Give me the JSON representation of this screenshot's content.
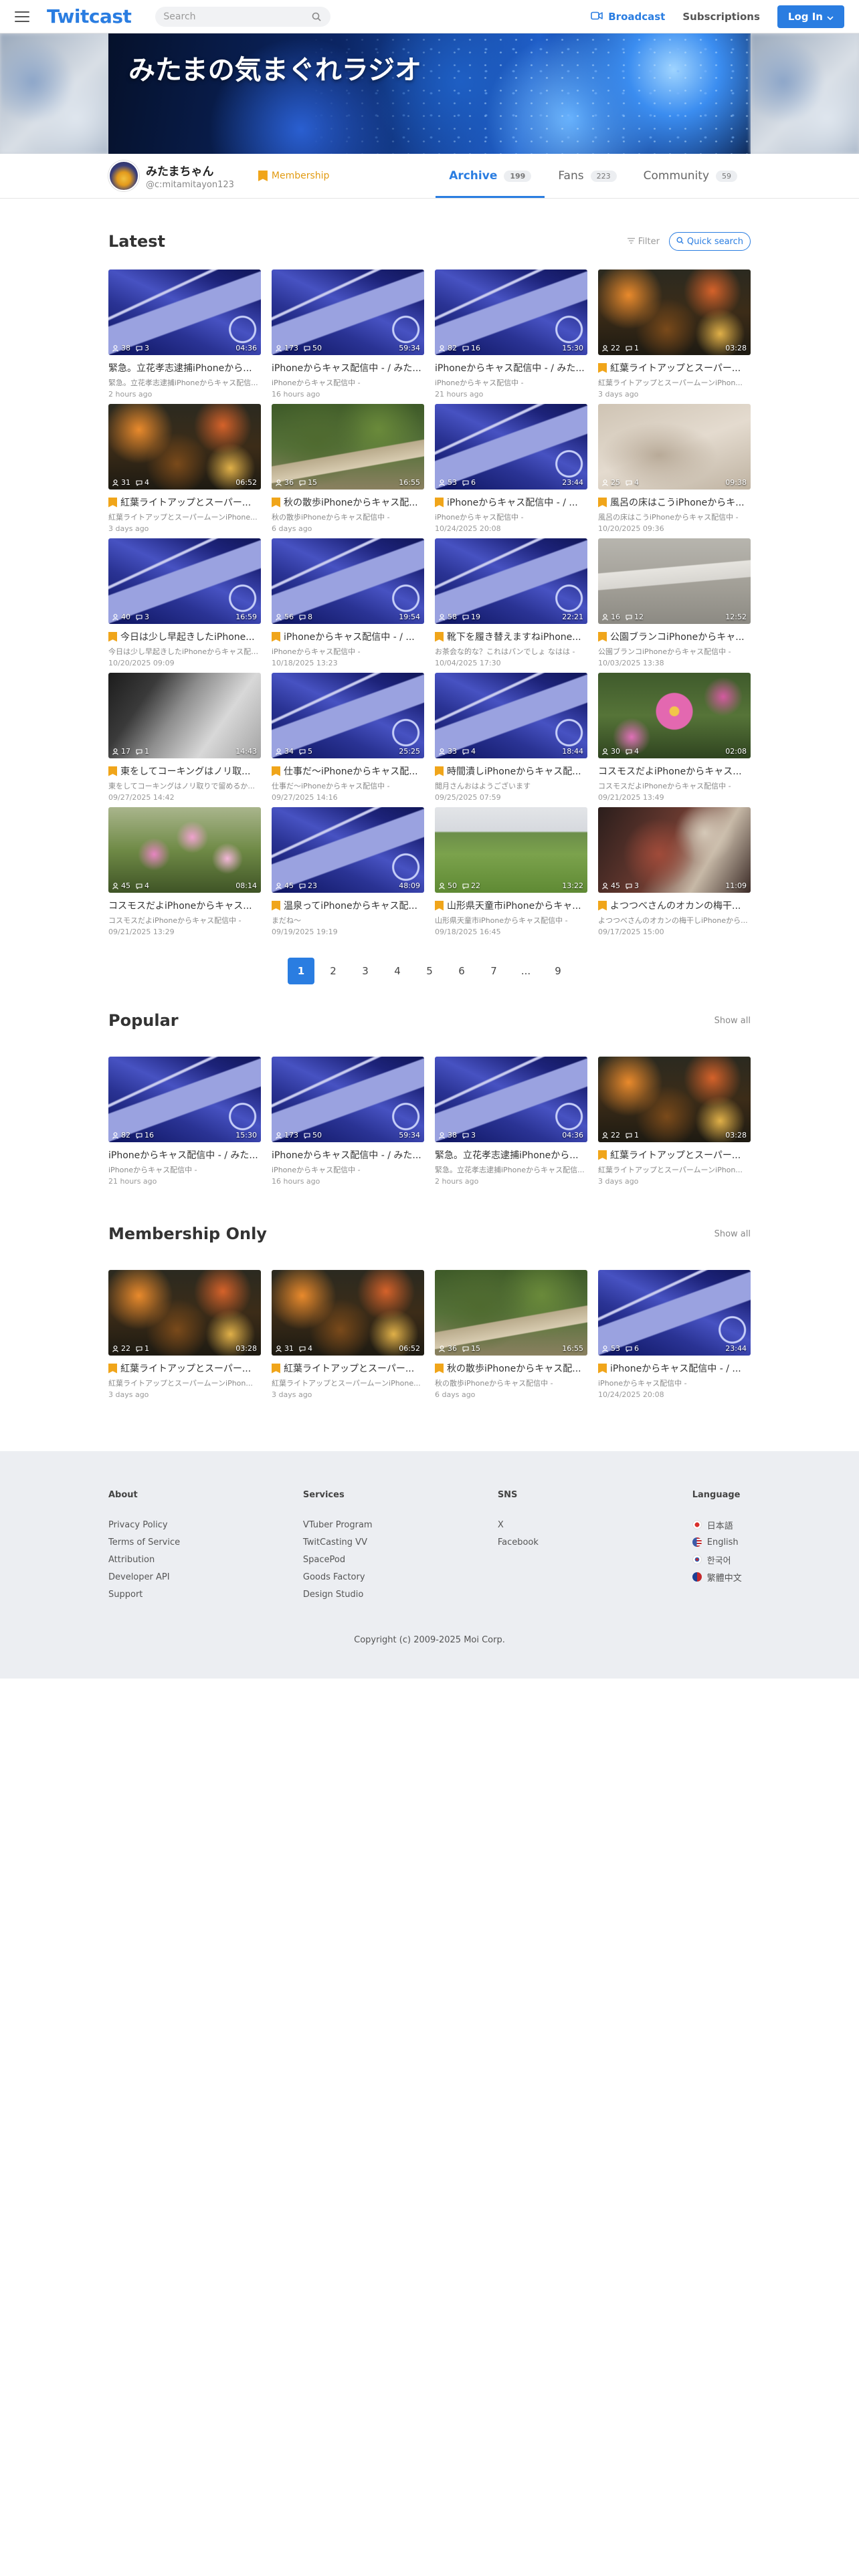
{
  "header": {
    "logo": "Twitcast",
    "search_placeholder": "Search",
    "broadcast_label": "Broadcast",
    "subscriptions_label": "Subscriptions",
    "login_label": "Log In",
    "accent": "#2a7de1"
  },
  "banner": {
    "title": "みたまの気まぐれラジオ"
  },
  "profile": {
    "name": "みたまちゃん",
    "handle": "@c:mitamitayon123",
    "membership_label": "Membership",
    "tabs": [
      {
        "label": "Archive",
        "count": "199"
      },
      {
        "label": "Fans",
        "count": "223"
      },
      {
        "label": "Community",
        "count": "59"
      }
    ]
  },
  "latest": {
    "title": "Latest",
    "filter_label": "Filter",
    "quick_search_label": "Quick search",
    "items": [
      {
        "thumb": "desk",
        "viewers": "38",
        "comments": "3",
        "duration": "04:36",
        "member": false,
        "title": "緊急。立花孝志逮捕iPhoneから...",
        "desc": "緊急。立花孝志逮捕iPhoneからキャス配信...",
        "date": "2 hours ago"
      },
      {
        "thumb": "desk",
        "viewers": "173",
        "comments": "50",
        "duration": "59:34",
        "member": false,
        "title": "iPhoneからキャス配信中 - / みた...",
        "desc": "iPhoneからキャス配信中 -",
        "date": "16 hours ago"
      },
      {
        "thumb": "desk",
        "viewers": "82",
        "comments": "16",
        "duration": "15:30",
        "member": false,
        "title": "iPhoneからキャス配信中 - / みた...",
        "desc": "iPhoneからキャス配信中 -",
        "date": "21 hours ago"
      },
      {
        "thumb": "autumn",
        "viewers": "22",
        "comments": "1",
        "duration": "03:28",
        "member": true,
        "title": "紅葉ライトアップとスーパー...",
        "desc": "紅葉ライトアップとスーパームーンiPhon...",
        "date": "3 days ago"
      },
      {
        "thumb": "autumn",
        "viewers": "31",
        "comments": "4",
        "duration": "06:52",
        "member": true,
        "title": "紅葉ライトアップとスーパー...",
        "desc": "紅葉ライトアップとスーパームーンiPhone...",
        "date": "3 days ago"
      },
      {
        "thumb": "forest",
        "viewers": "36",
        "comments": "15",
        "duration": "16:55",
        "member": true,
        "title": "秋の散歩iPhoneからキャス配...",
        "desc": "秋の散歩iPhoneからキャス配信中 -",
        "date": "6 days ago"
      },
      {
        "thumb": "desk",
        "viewers": "53",
        "comments": "6",
        "duration": "23:44",
        "member": true,
        "title": "iPhoneからキャス配信中 - / ...",
        "desc": "iPhoneからキャス配信中 -",
        "date": "10/24/2025 20:08"
      },
      {
        "thumb": "sand",
        "viewers": "25",
        "comments": "4",
        "duration": "09:38",
        "member": true,
        "title": "風呂の床はこうiPhoneからキ...",
        "desc": "風呂の床はこうiPhoneからキャス配信中 -",
        "date": "10/20/2025 09:36"
      },
      {
        "thumb": "desk",
        "viewers": "40",
        "comments": "3",
        "duration": "16:59",
        "member": true,
        "title": "今日は少し早起きしたiPhone...",
        "desc": "今日は少し早起きしたiPhoneからキャス配信...",
        "date": "10/20/2025 09:09"
      },
      {
        "thumb": "desk",
        "viewers": "56",
        "comments": "8",
        "duration": "19:54",
        "member": true,
        "title": "iPhoneからキャス配信中 - / ...",
        "desc": "iPhoneからキャス配信中 -",
        "date": "10/18/2025 13:23"
      },
      {
        "thumb": "desk",
        "viewers": "58",
        "comments": "19",
        "duration": "22:21",
        "member": true,
        "title": "靴下を履き替えますねiPhone...",
        "desc": "お茶会な的な？これはパンでしょ なはは -",
        "date": "10/04/2025 17:30"
      },
      {
        "thumb": "bench",
        "viewers": "16",
        "comments": "12",
        "duration": "12:52",
        "member": true,
        "title": "公園ブランコiPhoneからキャ...",
        "desc": "公園ブランコiPhoneからキャス配信中 -",
        "date": "10/03/2025 13:38"
      },
      {
        "thumb": "indoor",
        "viewers": "17",
        "comments": "1",
        "duration": "14:43",
        "member": true,
        "title": "東をしてコーキングはノリ取...",
        "desc": "東をしてコーキングはノリ取りで留めるか...",
        "date": "09/27/2025 14:42"
      },
      {
        "thumb": "desk",
        "viewers": "34",
        "comments": "5",
        "duration": "25:25",
        "member": true,
        "title": "仕事だ〜iPhoneからキャス配...",
        "desc": "仕事だ〜iPhoneからキャス配信中 -",
        "date": "09/27/2025 14:16"
      },
      {
        "thumb": "desk",
        "viewers": "33",
        "comments": "4",
        "duration": "18:44",
        "member": true,
        "title": "時間潰しiPhoneからキャス配...",
        "desc": "閲月さんおはようございます",
        "date": "09/25/2025 07:59"
      },
      {
        "thumb": "cosmos",
        "viewers": "30",
        "comments": "4",
        "duration": "02:08",
        "member": false,
        "title": "コスモスだよiPhoneからキャス...",
        "desc": "コスモスだよiPhoneからキャス配信中 -",
        "date": "09/21/2025 13:49"
      },
      {
        "thumb": "cosmos2",
        "viewers": "45",
        "comments": "4",
        "duration": "08:14",
        "member": false,
        "title": "コスモスだよiPhoneからキャス...",
        "desc": "コスモスだよiPhoneからキャス配信中 -",
        "date": "09/21/2025 13:29"
      },
      {
        "thumb": "desk",
        "viewers": "45",
        "comments": "23",
        "duration": "48:09",
        "member": true,
        "title": "温泉ってiPhoneからキャス配...",
        "desc": "まだね〜",
        "date": "09/19/2025 19:19"
      },
      {
        "thumb": "field",
        "viewers": "50",
        "comments": "22",
        "duration": "13:22",
        "member": true,
        "title": "山形県天童市iPhoneからキャ...",
        "desc": "山形県天童市iPhoneからキャス配信中 -",
        "date": "09/18/2025 16:45"
      },
      {
        "thumb": "food",
        "viewers": "45",
        "comments": "3",
        "duration": "11:09",
        "member": true,
        "title": "よつつべさんのオカンの梅干...",
        "desc": "よつつべさんのオカンの梅干しiPhoneから...",
        "date": "09/17/2025 15:00"
      }
    ]
  },
  "pagination": {
    "pages": [
      "1",
      "2",
      "3",
      "4",
      "5",
      "6",
      "7",
      "...",
      "9"
    ],
    "current": "1"
  },
  "popular": {
    "title": "Popular",
    "show_all": "Show all",
    "items": [
      {
        "thumb": "desk",
        "viewers": "82",
        "comments": "16",
        "duration": "15:30",
        "member": false,
        "title": "iPhoneからキャス配信中 - / みた...",
        "desc": "iPhoneからキャス配信中 -",
        "date": "21 hours ago"
      },
      {
        "thumb": "desk",
        "viewers": "173",
        "comments": "50",
        "duration": "59:34",
        "member": false,
        "title": "iPhoneからキャス配信中 - / みた...",
        "desc": "iPhoneからキャス配信中 -",
        "date": "16 hours ago"
      },
      {
        "thumb": "desk",
        "viewers": "38",
        "comments": "3",
        "duration": "04:36",
        "member": false,
        "title": "緊急。立花孝志逮捕iPhoneから...",
        "desc": "緊急。立花孝志逮捕iPhoneからキャス配信...",
        "date": "2 hours ago"
      },
      {
        "thumb": "autumn",
        "viewers": "22",
        "comments": "1",
        "duration": "03:28",
        "member": true,
        "title": "紅葉ライトアップとスーパー...",
        "desc": "紅葉ライトアップとスーパームーンiPhon...",
        "date": "3 days ago"
      }
    ]
  },
  "membership_only": {
    "title": "Membership Only",
    "show_all": "Show all",
    "items": [
      {
        "thumb": "autumn",
        "viewers": "22",
        "comments": "1",
        "duration": "03:28",
        "member": true,
        "title": "紅葉ライトアップとスーパー...",
        "desc": "紅葉ライトアップとスーパームーンiPhon...",
        "date": "3 days ago"
      },
      {
        "thumb": "autumn",
        "viewers": "31",
        "comments": "4",
        "duration": "06:52",
        "member": true,
        "title": "紅葉ライトアップとスーパー...",
        "desc": "紅葉ライトアップとスーパームーンiPhone...",
        "date": "3 days ago"
      },
      {
        "thumb": "forest",
        "viewers": "36",
        "comments": "15",
        "duration": "16:55",
        "member": true,
        "title": "秋の散歩iPhoneからキャス配...",
        "desc": "秋の散歩iPhoneからキャス配信中 -",
        "date": "6 days ago"
      },
      {
        "thumb": "desk",
        "viewers": "53",
        "comments": "6",
        "duration": "23:44",
        "member": true,
        "title": "iPhoneからキャス配信中 - / ...",
        "desc": "iPhoneからキャス配信中 -",
        "date": "10/24/2025 20:08"
      }
    ]
  },
  "footer": {
    "about": {
      "heading": "About",
      "links": [
        "Privacy Policy",
        "Terms of Service",
        "Attribution",
        "Developer API",
        "Support"
      ]
    },
    "services": {
      "heading": "Services",
      "links": [
        "VTuber Program",
        "TwitCasting VV",
        "SpacePod",
        "Goods Factory",
        "Design Studio"
      ]
    },
    "sns": {
      "heading": "SNS",
      "links": [
        "X",
        "Facebook"
      ]
    },
    "language": {
      "heading": "Language",
      "links": [
        {
          "label": "日本語",
          "color": "#d9302c"
        },
        {
          "label": "English",
          "color": "#3b5aa8"
        },
        {
          "label": "한국어",
          "color": "#2d62b8"
        },
        {
          "label": "繁體中文",
          "color": "#c4282c"
        }
      ]
    },
    "copyright": "Copyright (c) 2009-2025 Moi Corp."
  }
}
